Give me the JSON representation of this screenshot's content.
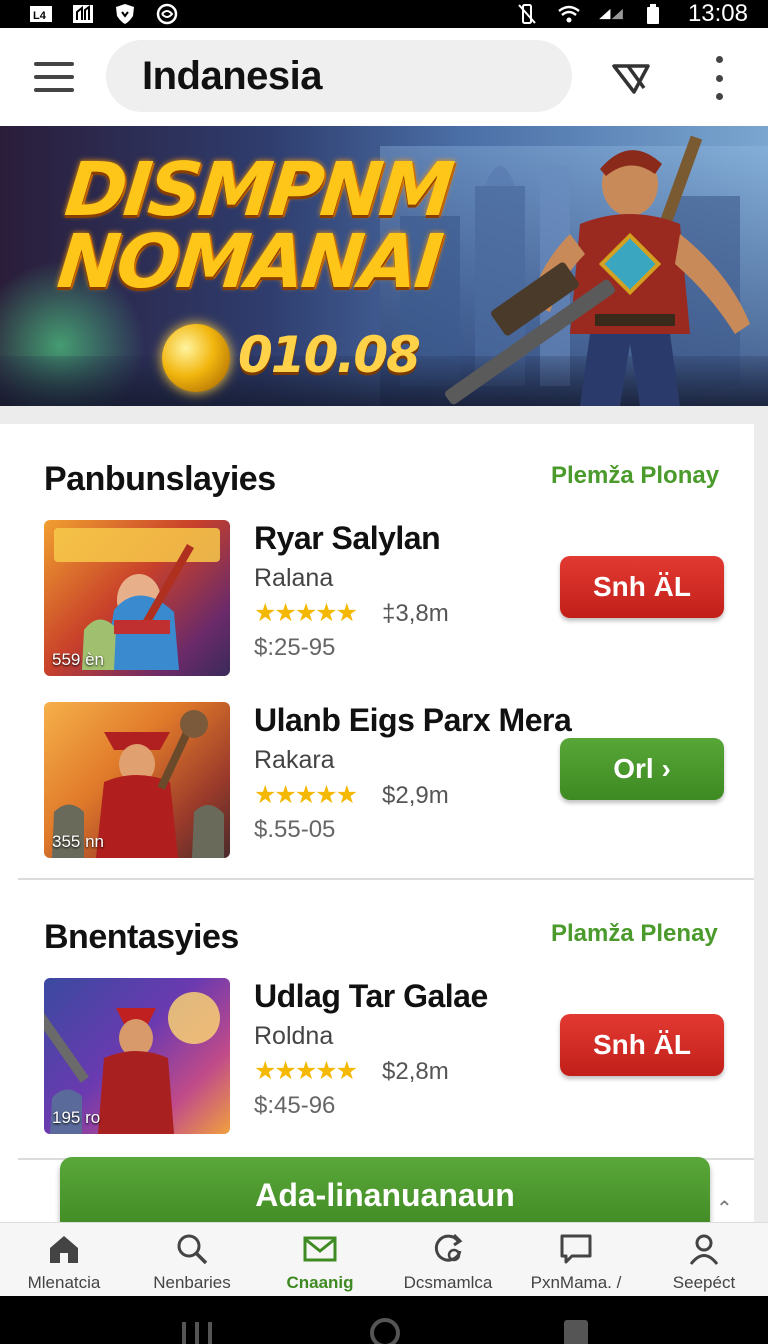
{
  "status_bar": {
    "left_icons": [
      "l4-icon",
      "signal-box-icon",
      "shield-icon",
      "sync-icon"
    ],
    "right_icons": [
      "vibrate-icon",
      "wifi-icon",
      "cell-signal-icon",
      "battery-icon"
    ],
    "time": "13:08"
  },
  "app_bar": {
    "search_text": "Indanesia",
    "icons": [
      "menu-icon",
      "filter-icon",
      "more-vert-icon"
    ]
  },
  "banner": {
    "title_line1": "DISMPNM",
    "title_line2": "NOMANAI",
    "amount": "010.08",
    "colors": {
      "title": "#ffc61a",
      "coin": "#f2b60e"
    }
  },
  "sections": [
    {
      "title": "Panbunslayies",
      "link": "Plemža Plonay",
      "items": [
        {
          "name": "Ryar Salylan",
          "sub": "Ralana",
          "stars": "★★★★★",
          "meta": "‡3,8m",
          "price": "$:25-95",
          "thumb_badge": "559 ѐn",
          "cta": "Snh ÄL",
          "cta_color": "red"
        },
        {
          "name": "Ulanb Eigs Parx Mera",
          "sub": "Rakara",
          "stars": "★★★★★",
          "meta": "$2,9m",
          "price": "$.55-05",
          "thumb_badge": "355 nn",
          "cta": "Orl ›",
          "cta_color": "green"
        }
      ]
    },
    {
      "title": "Bnentasyies",
      "link": "Plamža Plenay",
      "items": [
        {
          "name": "Udlag Tar Galae",
          "sub": "Roldna",
          "stars": "★★★★★",
          "meta": "$2,8m",
          "price": "$:45-96",
          "thumb_badge": "195 ro",
          "cta": "Snh ÄL",
          "cta_color": "red"
        }
      ]
    }
  ],
  "fab": {
    "label": "Ada-linanuanaun"
  },
  "bottom_nav": [
    {
      "label": "Mlenatcia",
      "icon": "home-icon",
      "active": false
    },
    {
      "label": "Nenbaries",
      "icon": "search-icon",
      "active": false
    },
    {
      "label": "Cnaanig",
      "icon": "mail-icon",
      "active": true
    },
    {
      "label": "Dcsmamlca",
      "icon": "refresh-search-icon",
      "active": false
    },
    {
      "label": "PxnMama. /",
      "icon": "chat-icon",
      "active": false
    },
    {
      "label": "Seepéct",
      "icon": "person-icon",
      "active": false
    }
  ],
  "accent_colors": {
    "green": "#4b9a2c",
    "red": "#c21f1a"
  }
}
